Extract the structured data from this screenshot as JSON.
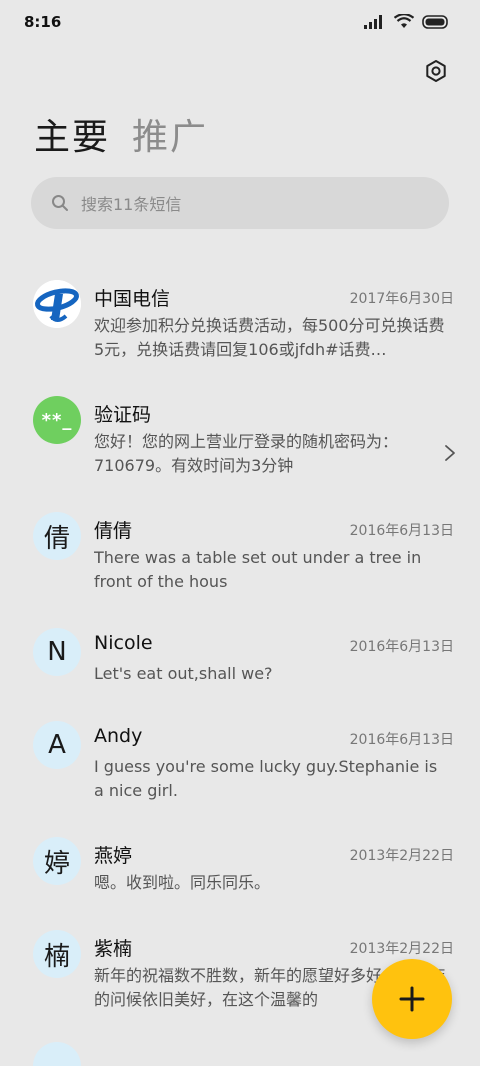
{
  "status_bar": {
    "time": "8:16"
  },
  "header": {
    "settings_icon": "gear-icon",
    "tabs": [
      {
        "label": "主要",
        "active": true
      },
      {
        "label": "推广",
        "active": false
      }
    ]
  },
  "search": {
    "placeholder": "搜索11条短信"
  },
  "conversations": [
    {
      "avatar_type": "logo",
      "avatar_text": "",
      "name": "中国电信",
      "date": "2017年6月30日",
      "preview": "欢迎参加积分兑换话费活动，每500分可兑换话费5元，兑换话费请回复106或jfdh#话费…"
    },
    {
      "avatar_type": "code",
      "avatar_text": "**_",
      "name": "验证码",
      "date": "",
      "preview": "您好！您的网上营业厅登录的随机密码为：710679。有效时间为3分钟"
    },
    {
      "avatar_type": "letter",
      "avatar_text": "倩",
      "name": "倩倩",
      "date": "2016年6月13日",
      "preview": "There was a table set out under a tree in front of the hous"
    },
    {
      "avatar_type": "letter",
      "avatar_text": "N",
      "name": "Nicole",
      "date": "2016年6月13日",
      "preview": "Let's eat out,shall we?"
    },
    {
      "avatar_type": "letter",
      "avatar_text": "A",
      "name": "Andy",
      "date": "2016年6月13日",
      "preview": "I guess you're some lucky guy.Stephanie is a nice girl."
    },
    {
      "avatar_type": "letter",
      "avatar_text": "婷",
      "name": "燕婷",
      "date": "2013年2月22日",
      "preview": "嗯。收到啦。同乐同乐。"
    },
    {
      "avatar_type": "letter",
      "avatar_text": "楠",
      "name": "紫楠",
      "date": "2013年2月22日",
      "preview": "新年的祝福数不胜数，新年的愿望好多好多，新年的问候依旧美好，在这个温馨的"
    }
  ],
  "fab": {
    "icon": "plus-icon"
  },
  "colors": {
    "background": "#e8e8e8",
    "fab": "#ffc20e",
    "avatar_bg": "#d9eef9",
    "code_avatar": "#6fcf5f",
    "telecom_blue": "#1565c0"
  }
}
